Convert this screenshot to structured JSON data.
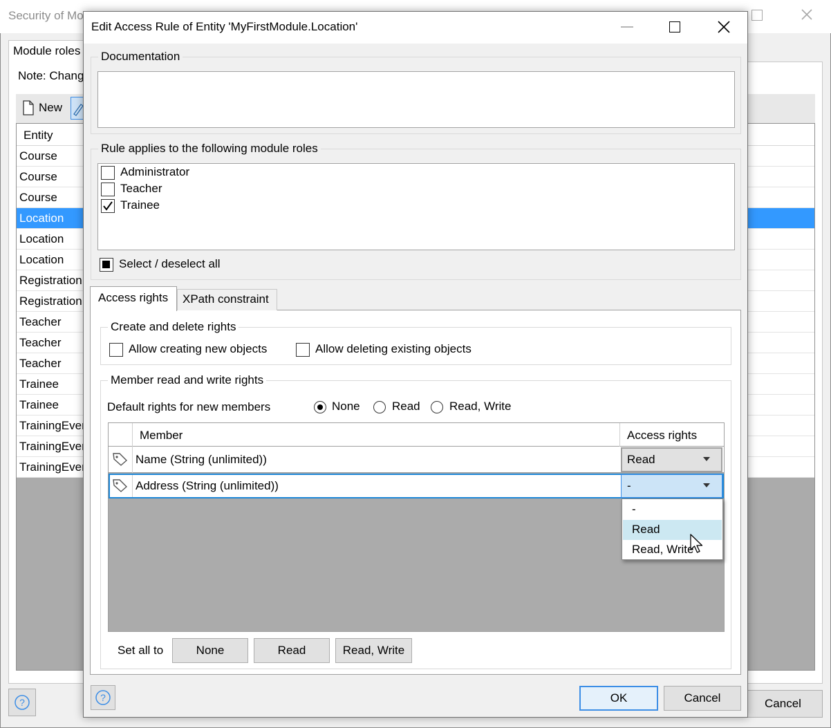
{
  "background_window": {
    "title": "Security of Mo",
    "tab": "Module roles",
    "note": "Note: Chang",
    "new_label": "New",
    "column_header": "Entity",
    "rows": [
      "Course",
      "Course",
      "Course",
      "Location",
      "Location",
      "Location",
      "Registration",
      "Registration",
      "Teacher",
      "Teacher",
      "Teacher",
      "Trainee",
      "Trainee",
      "TrainingEver",
      "TrainingEver",
      "TrainingEver"
    ],
    "selected_row_index": 3,
    "cancel_label": "Cancel"
  },
  "dialog": {
    "title": "Edit Access Rule of Entity 'MyFirstModule.Location'",
    "documentation": {
      "legend": "Documentation",
      "value": ""
    },
    "roles": {
      "legend": "Rule applies to the following module roles",
      "items": [
        {
          "label": "Administrator",
          "checked": false
        },
        {
          "label": "Teacher",
          "checked": false
        },
        {
          "label": "Trainee",
          "checked": true
        }
      ],
      "select_all_label": "Select / deselect all"
    },
    "tabs": [
      {
        "label": "Access rights",
        "active": true
      },
      {
        "label": "XPath constraint",
        "active": false
      }
    ],
    "create_delete": {
      "legend": "Create and delete rights",
      "allow_create": "Allow creating new objects",
      "allow_delete": "Allow deleting existing objects"
    },
    "member_rights": {
      "legend": "Member read and write rights",
      "default_label": "Default rights for new members",
      "default_options": [
        "None",
        "Read",
        "Read, Write"
      ],
      "default_selected": "None",
      "columns": {
        "member": "Member",
        "access": "Access rights"
      },
      "rows": [
        {
          "member": "Name (String (unlimited))",
          "access": "Read"
        },
        {
          "member": "Address (String (unlimited))",
          "access": "-"
        }
      ],
      "dropdown_options": [
        "-",
        "Read",
        "Read, Write"
      ],
      "dropdown_highlighted": "Read",
      "set_all_label": "Set all to",
      "set_all_buttons": [
        "None",
        "Read",
        "Read, Write"
      ]
    },
    "ok_label": "OK",
    "cancel_label": "Cancel"
  },
  "colors": {
    "selection": "#3399ff",
    "focus_border": "#1e88d8",
    "dropdown_highlight": "#cce8f2",
    "grid_empty": "#ababab"
  }
}
